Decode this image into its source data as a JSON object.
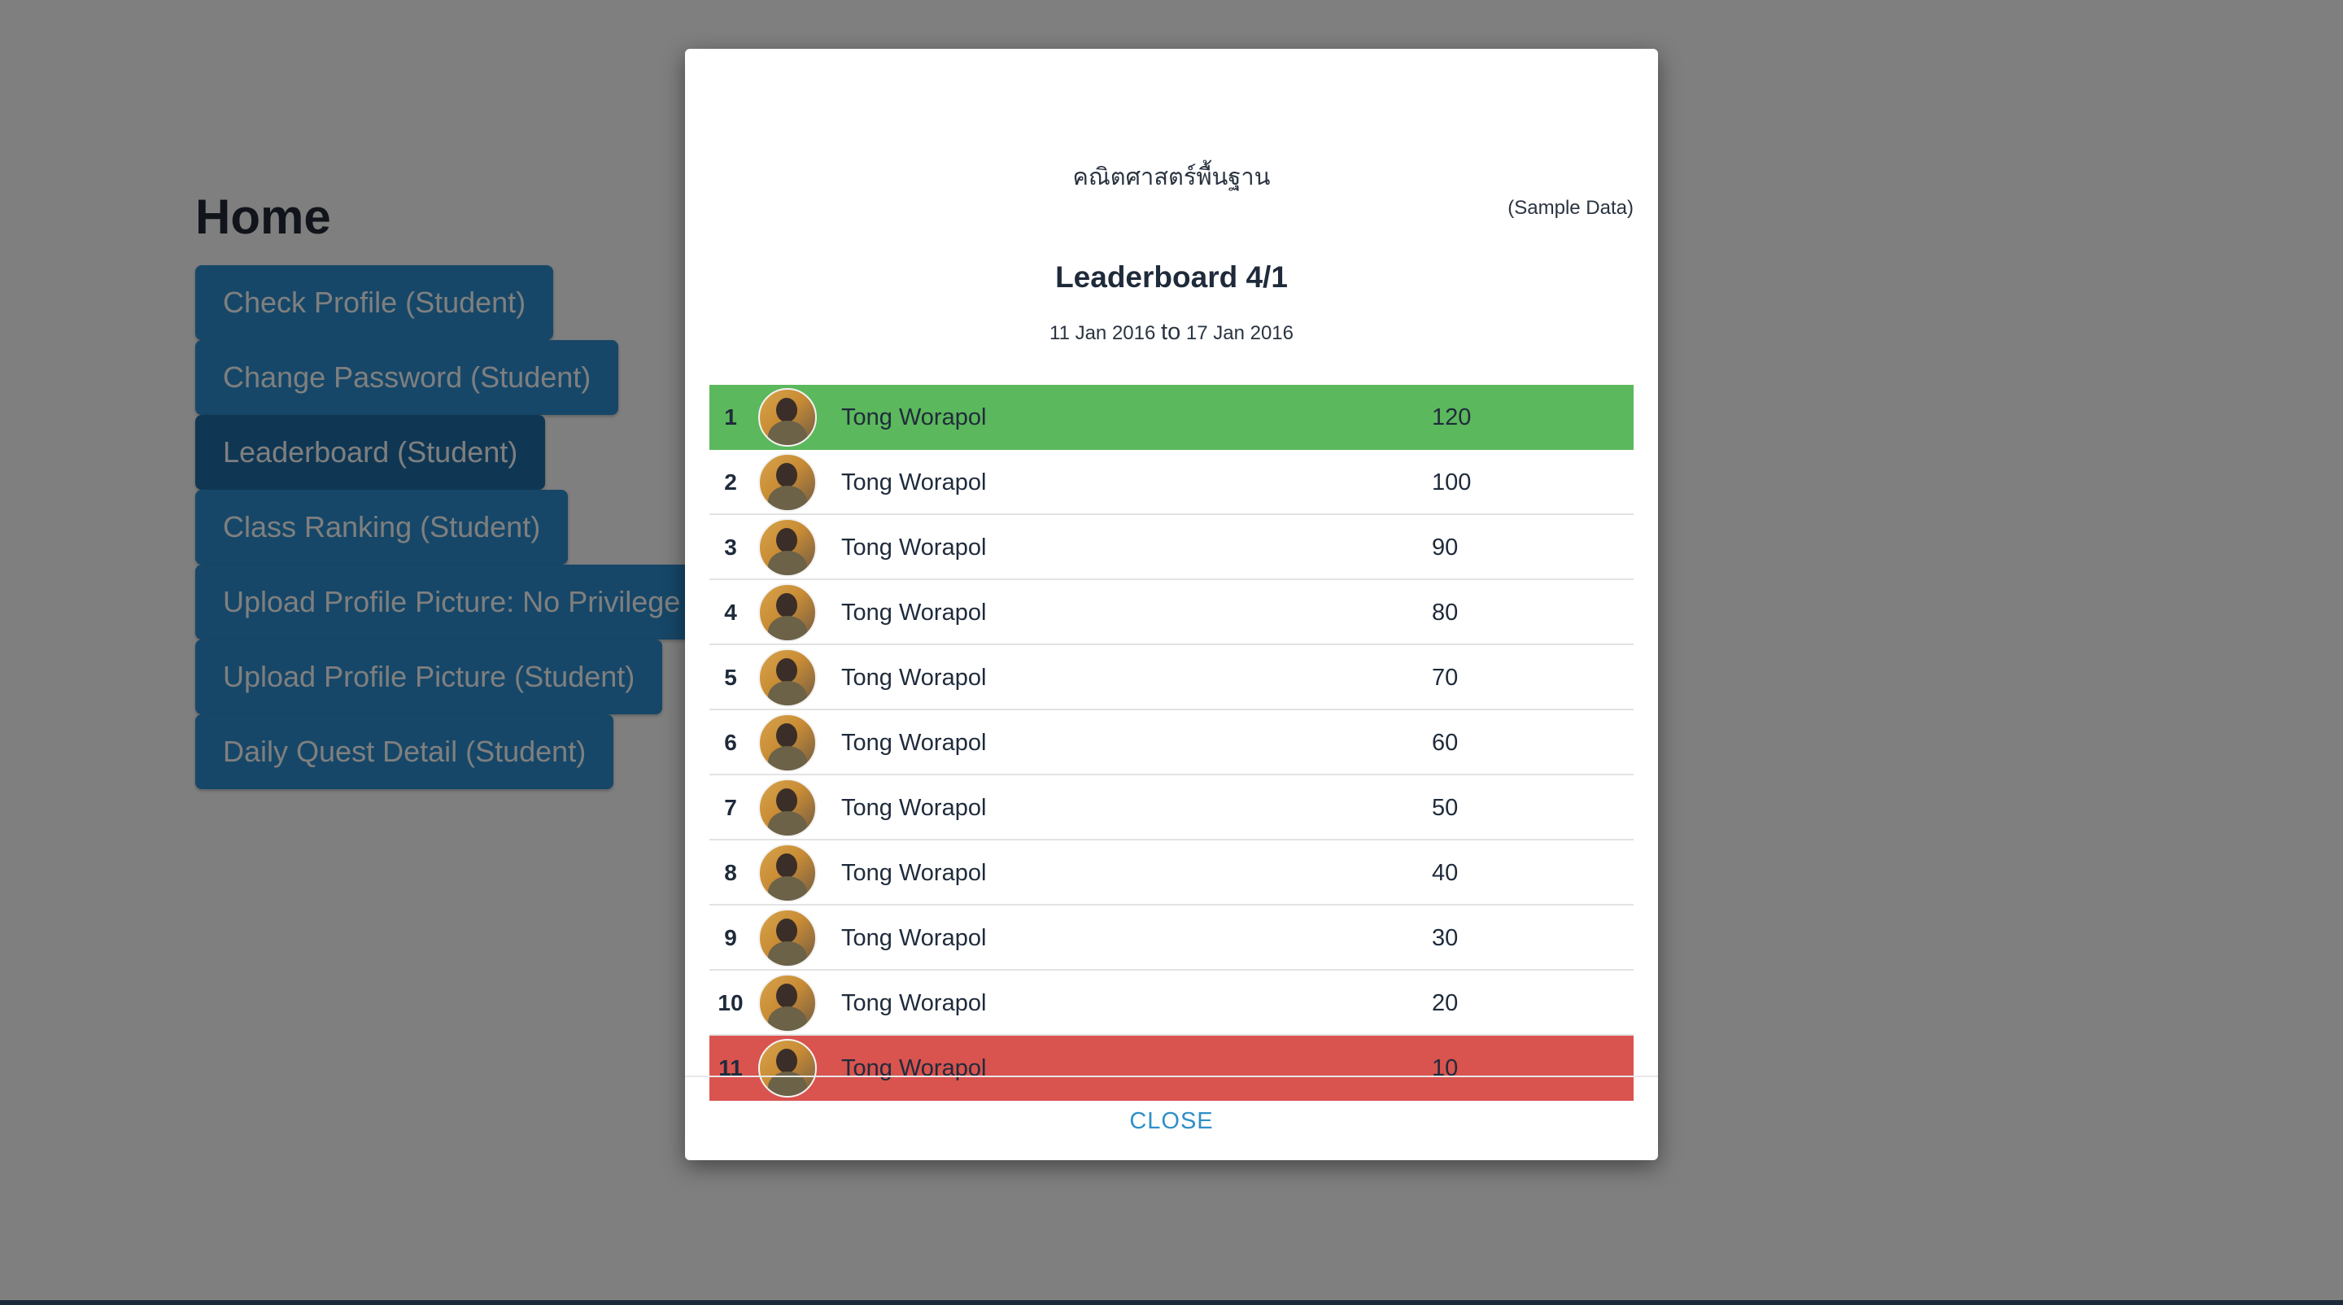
{
  "home": {
    "title": "Home",
    "buttons": [
      {
        "label": "Check Profile (Student)"
      },
      {
        "label": "Change Password (Student)"
      },
      {
        "label": "Leaderboard (Student)"
      },
      {
        "label": "Class Ranking (Student)"
      },
      {
        "label": "Upload Profile Picture: No Privilege"
      },
      {
        "label": "Upload Profile Picture (Student)"
      },
      {
        "label": "Daily Quest Detail (Student)"
      }
    ]
  },
  "modal": {
    "course_name": "คณิตศาสตร์พื้นฐาน",
    "sample_note": "(Sample Data)",
    "title": "Leaderboard 4/1",
    "date_from": "11 Jan 2016",
    "date_sep": "to",
    "date_to": "17 Jan 2016",
    "rows": [
      {
        "rank": "1",
        "name": "Tong Worapol",
        "score": "120"
      },
      {
        "rank": "2",
        "name": "Tong Worapol",
        "score": "100"
      },
      {
        "rank": "3",
        "name": "Tong Worapol",
        "score": "90"
      },
      {
        "rank": "4",
        "name": "Tong Worapol",
        "score": "80"
      },
      {
        "rank": "5",
        "name": "Tong Worapol",
        "score": "70"
      },
      {
        "rank": "6",
        "name": "Tong Worapol",
        "score": "60"
      },
      {
        "rank": "7",
        "name": "Tong Worapol",
        "score": "50"
      },
      {
        "rank": "8",
        "name": "Tong Worapol",
        "score": "40"
      },
      {
        "rank": "9",
        "name": "Tong Worapol",
        "score": "30"
      },
      {
        "rank": "10",
        "name": "Tong Worapol",
        "score": "20"
      },
      {
        "rank": "11",
        "name": "Tong Worapol",
        "score": "10"
      }
    ],
    "close_label": "CLOSE"
  },
  "colors": {
    "top_row": "#5cb85c",
    "bottom_row": "#d9534f",
    "button": "#2c8fd0",
    "close_text": "#2f8fc7"
  }
}
